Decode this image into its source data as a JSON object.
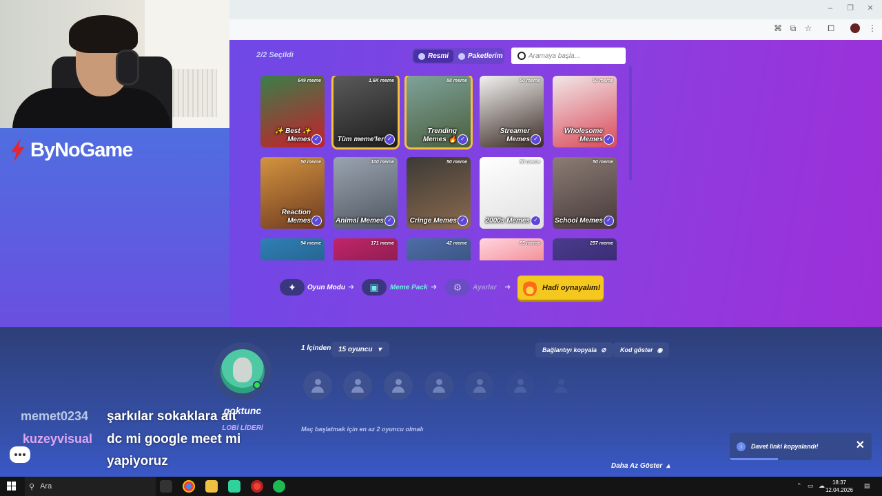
{
  "app": {
    "logo_text": "ByNoGame"
  },
  "meme_pack": {
    "selected_count": "2/2 Seçildi",
    "tabs": [
      {
        "label": "Resmi",
        "active": true
      },
      {
        "label": "Paketlerim",
        "active": false
      }
    ],
    "search_placeholder": "Aramaya başla...",
    "packs": [
      {
        "count": "649 meme",
        "name_line1": "✨ Best ✨",
        "name_line2": "Memes",
        "selected": false,
        "colors": [
          "#3a7e4a",
          "#c6202a"
        ]
      },
      {
        "count": "1.6K meme",
        "name_line1": "",
        "name_line2": "Tüm meme'ler",
        "selected": true,
        "colors": [
          "#5a5a5a",
          "#1e1e1e"
        ]
      },
      {
        "count": "88 meme",
        "name_line1": "Trending",
        "name_line2": "Memes 🔥",
        "selected": true,
        "colors": [
          "#7fa39a",
          "#4a5e3e"
        ]
      },
      {
        "count": "50 meme",
        "name_line1": "Streamer",
        "name_line2": "Memes",
        "selected": false,
        "colors": [
          "#f2f2f2",
          "#3b2a22"
        ]
      },
      {
        "count": "50 meme",
        "name_line1": "Wholesome",
        "name_line2": "Memes",
        "selected": false,
        "colors": [
          "#f1e8e8",
          "#d94a5a"
        ]
      },
      {
        "count": "50 meme",
        "name_line1": "Reaction",
        "name_line2": "Memes",
        "selected": false,
        "colors": [
          "#d39440",
          "#6e3a20"
        ]
      },
      {
        "count": "100 meme",
        "name_line1": "",
        "name_line2": "Animal Memes",
        "selected": false,
        "colors": [
          "#9aa4b0",
          "#4e5660"
        ]
      },
      {
        "count": "50 meme",
        "name_line1": "",
        "name_line2": "Cringe Memes",
        "selected": false,
        "colors": [
          "#3c3a36",
          "#8b6a4e"
        ]
      },
      {
        "count": "50 meme",
        "name_line1": "",
        "name_line2": "2000s Memes",
        "selected": false,
        "colors": [
          "#ffffff",
          "#e0e0e0"
        ]
      },
      {
        "count": "50 meme",
        "name_line1": "",
        "name_line2": "School Memes",
        "selected": false,
        "colors": [
          "#8c7c74",
          "#463a3a"
        ]
      },
      {
        "count": "94 meme",
        "name_line1": "",
        "name_line2": "",
        "selected": false,
        "colors": [
          "#2f7fb5",
          "#1c4c6e"
        ]
      },
      {
        "count": "171 meme",
        "name_line1": "",
        "name_line2": "",
        "selected": false,
        "colors": [
          "#c2256a",
          "#5a1636"
        ]
      },
      {
        "count": "42 meme",
        "name_line1": "",
        "name_line2": "",
        "selected": false,
        "colors": [
          "#4e6ea8",
          "#2a3b60"
        ]
      },
      {
        "count": "65 meme",
        "name_line1": "",
        "name_line2": "",
        "selected": false,
        "colors": [
          "#ffd4e0",
          "#e84a4a"
        ]
      },
      {
        "count": "257 meme",
        "name_line1": "",
        "name_line2": "",
        "selected": false,
        "colors": [
          "#4a3c8c",
          "#2a1c5a"
        ]
      }
    ]
  },
  "steps": [
    {
      "label": "Oyun Modu",
      "state": "done"
    },
    {
      "label": "Meme Pack",
      "state": "current"
    },
    {
      "label": "Ayarlar",
      "state": "upcoming"
    }
  ],
  "play_button": "Hadi oynayalım!",
  "lobby": {
    "player_name": "goktunc",
    "leader_label": "LOBİ LİDERİ",
    "count_label": "1 İçinden",
    "player_select": "15 oyuncu",
    "copy_link": "Bağlantıyı kopyala",
    "show_code": "Kod göster",
    "min_note": "Maç başlatmak için en az 2 oyuncu olmalı",
    "show_less": "Daha Az Göster"
  },
  "toast": {
    "text": "Davet linki kopyalandı!"
  },
  "stream_chat": [
    {
      "user": "memet0234",
      "message": "şarkılar sokaklara ait",
      "color": "#b9c9e6"
    },
    {
      "user": "kuzeyvisual",
      "message": "dc mi google meet mi",
      "message2": "yapiyoruz",
      "color": "#e0a6f0"
    }
  ],
  "taskbar": {
    "search_label": "Ara",
    "time": "18:37",
    "date": "12.04.2026"
  }
}
